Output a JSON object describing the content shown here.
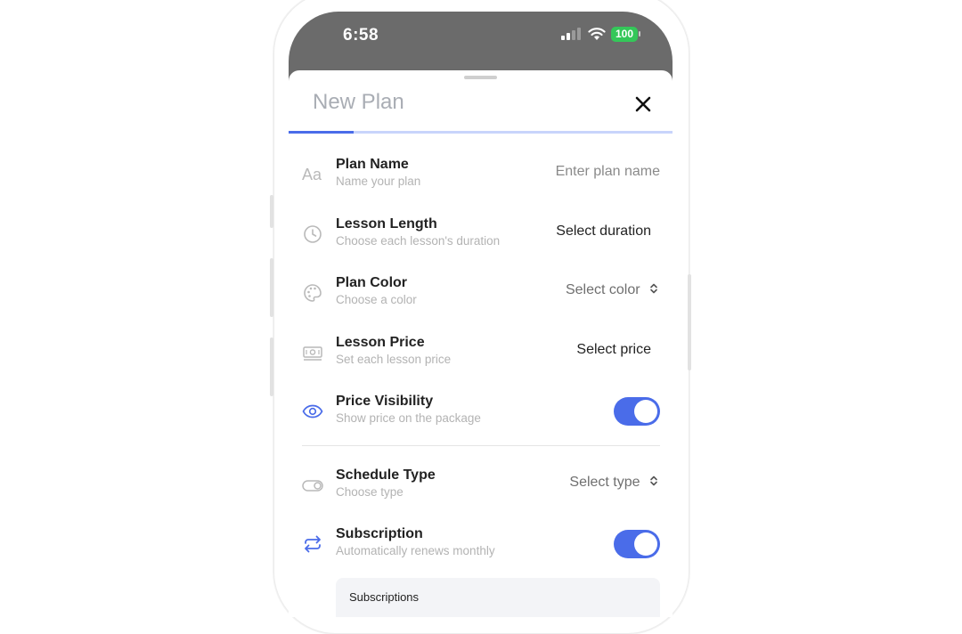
{
  "status_bar": {
    "time": "6:58",
    "battery": "100"
  },
  "sheet": {
    "title": "New Plan",
    "progress_fraction": 0.17
  },
  "rows": [
    {
      "label": "Plan Name",
      "sub": "Name your plan",
      "value": "Enter plan name",
      "icon": "text-aa-icon"
    },
    {
      "label": "Lesson Length",
      "sub": "Choose each lesson's duration",
      "value": "Select duration",
      "icon": "clock-icon"
    },
    {
      "label": "Plan Color",
      "sub": "Choose a color",
      "value": "Select color",
      "icon": "palette-icon"
    },
    {
      "label": "Lesson Price",
      "sub": "Set each lesson price",
      "value": "Select price",
      "icon": "money-icon"
    },
    {
      "label": "Price Visibility",
      "sub": "Show price on the package",
      "toggle_on": true,
      "icon": "eye-icon"
    },
    {
      "label": "Schedule Type",
      "sub": "Choose type",
      "value": "Select type",
      "icon": "toggle-outline-icon"
    },
    {
      "label": "Subscription",
      "sub": "Automatically renews monthly",
      "toggle_on": true,
      "icon": "repeat-icon"
    }
  ],
  "subscriptions_box": {
    "title": "Subscriptions"
  },
  "colors": {
    "accent": "#4a6ce9",
    "battery": "#34c759",
    "status_bg": "#6b6b6b"
  }
}
